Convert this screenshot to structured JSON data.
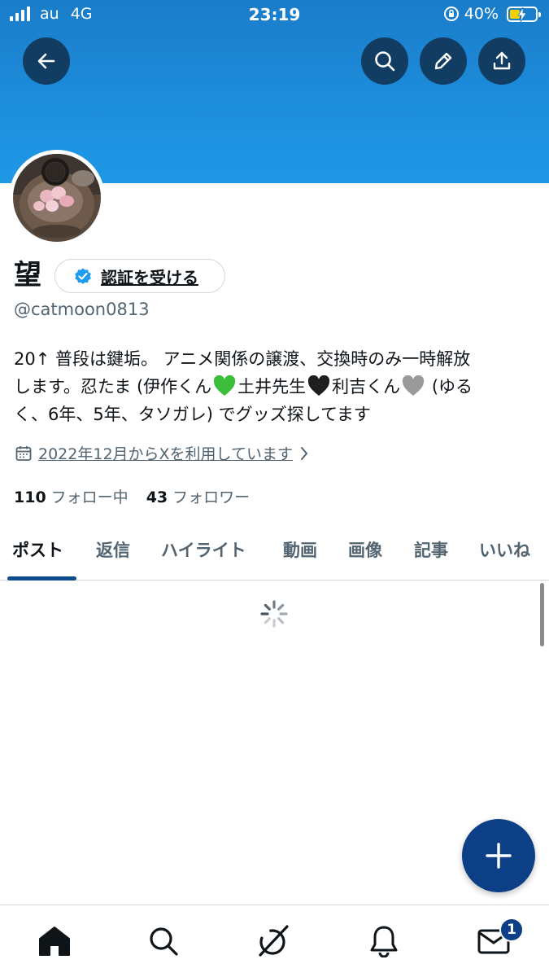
{
  "status_bar": {
    "carrier": "au",
    "network": "4G",
    "time": "23:19",
    "battery": "40%"
  },
  "profile": {
    "name": "望",
    "verify_label": "認証を受ける",
    "handle": "@catmoon0813",
    "bio_line1": "20↑ 普段は鍵垢。 アニメ関係の譲渡、交換時のみ一時解放",
    "bio_line2_a": "します。忍たま (伊作くん",
    "bio_line2_b": "土井先生",
    "bio_line2_c": "利吉くん",
    "bio_line2_d": " (ゆる",
    "bio_line3": "く、6年、5年、タソガレ) でグッズ探してます",
    "joined": "2022年12月からXを利用しています",
    "following_count": "110",
    "following_label": "フォロー中",
    "followers_count": "43",
    "followers_label": "フォロワー"
  },
  "tabs": [
    "ポスト",
    "返信",
    "ハイライト",
    "動画",
    "画像",
    "記事",
    "いいね"
  ],
  "bottom_nav": {
    "messages_badge": "1"
  },
  "colors": {
    "banner": "#1d8ddb",
    "accent": "#0c3f86",
    "verified": "#1d9bf0"
  }
}
